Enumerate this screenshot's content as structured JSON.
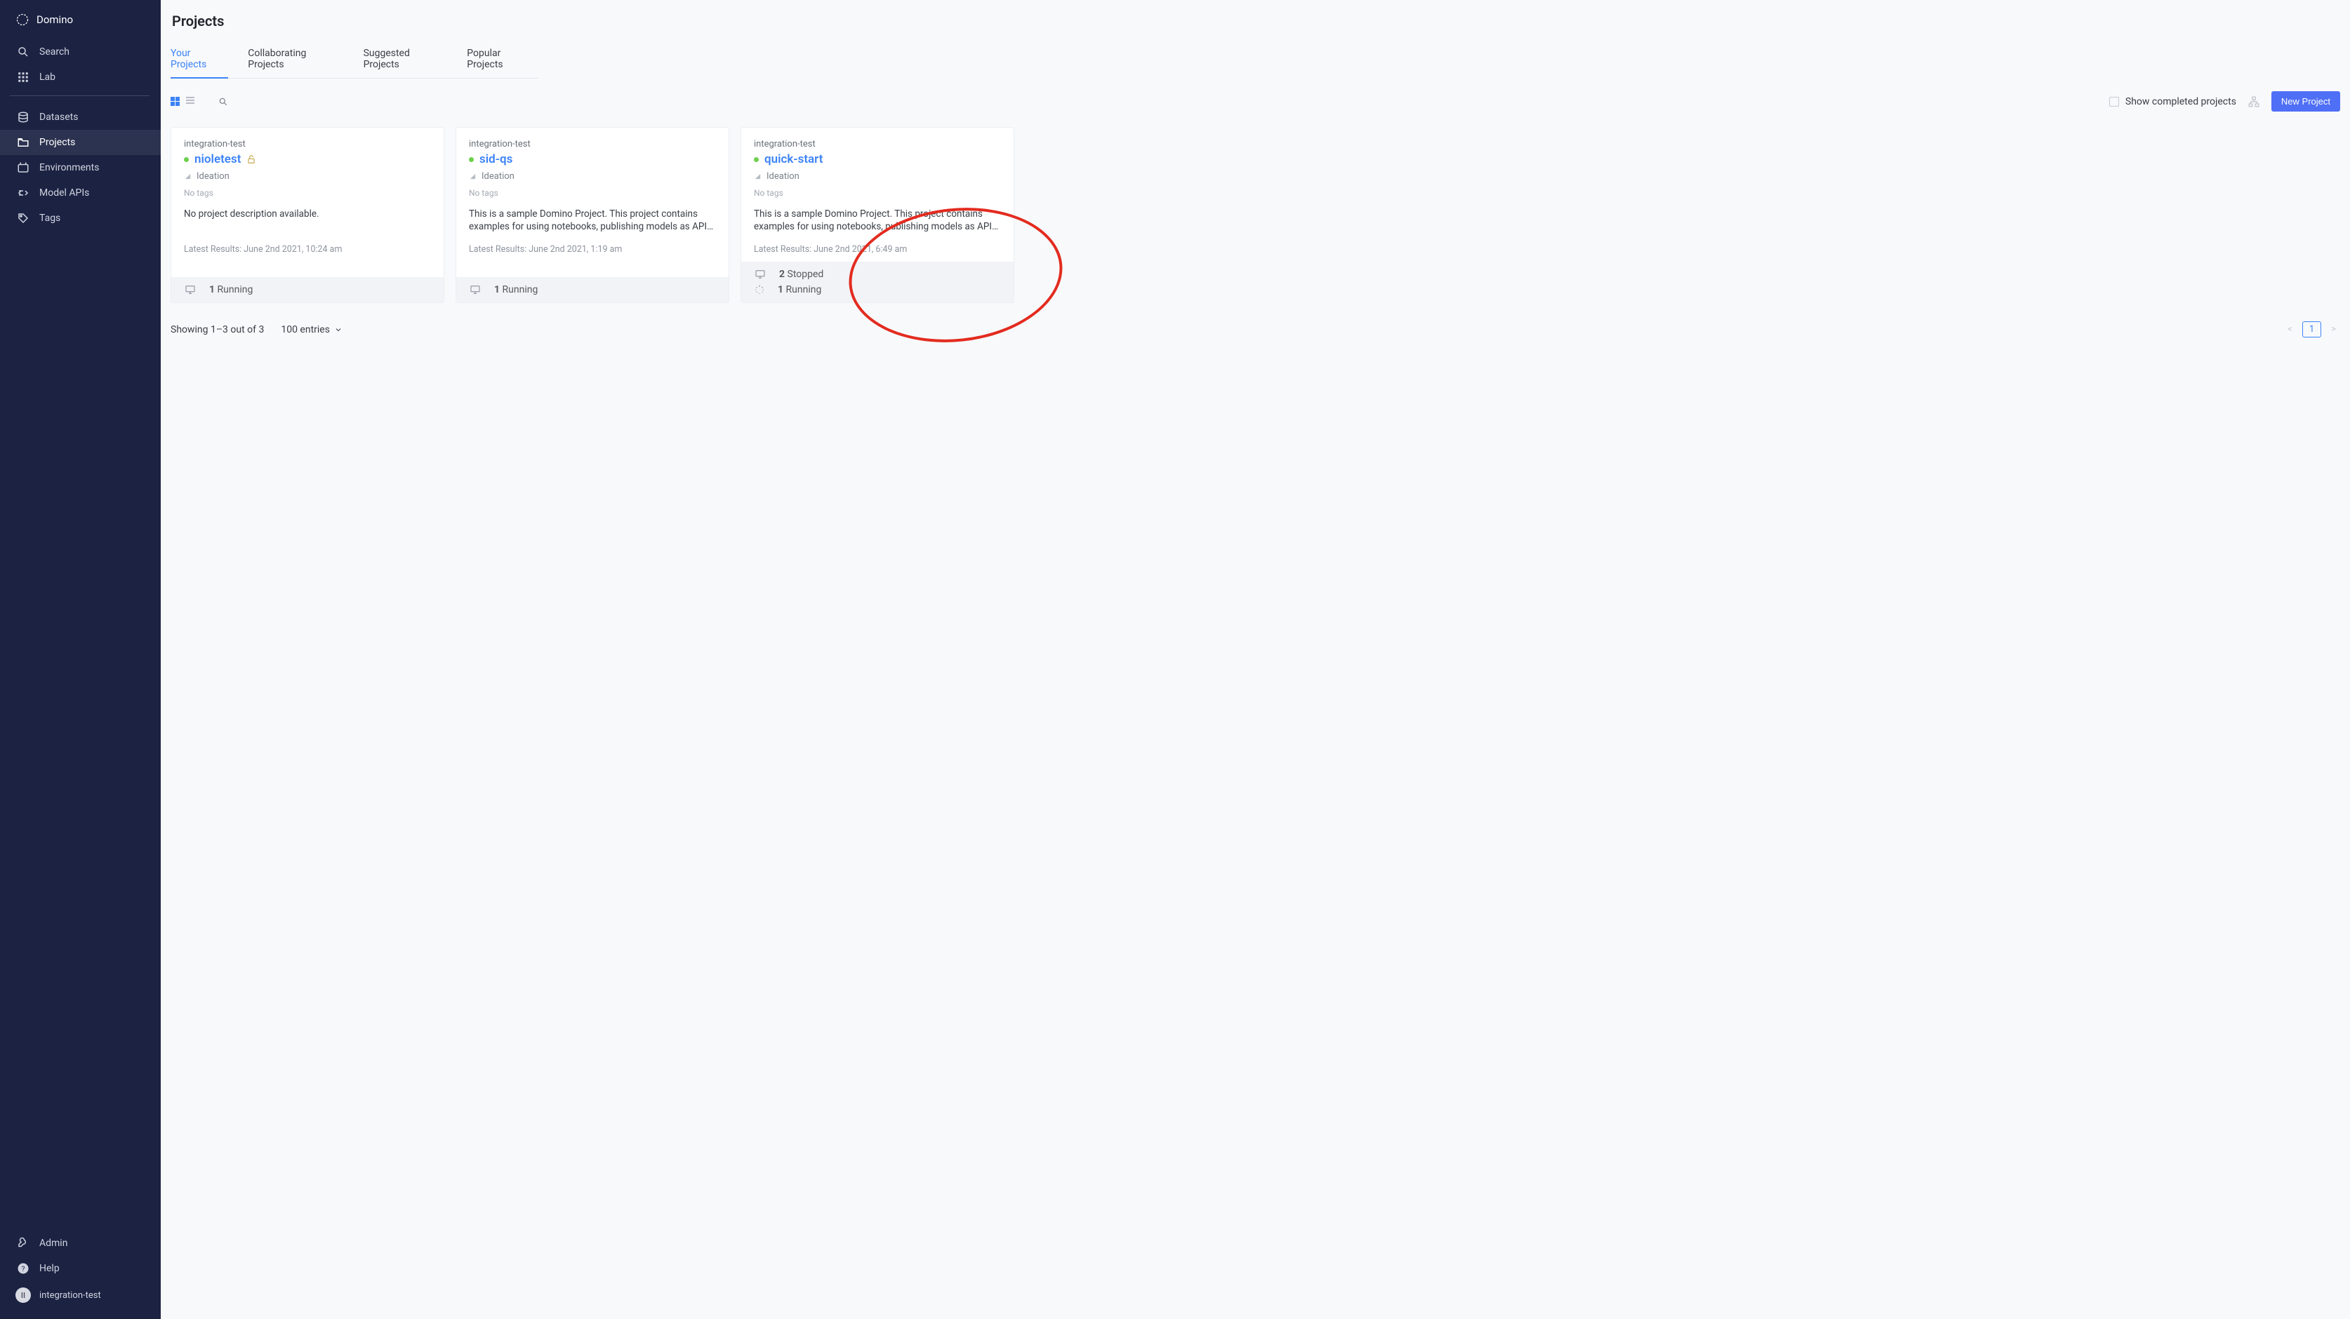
{
  "brand": "Domino",
  "sidebar": {
    "top": [
      {
        "icon": "search-icon",
        "label": "Search"
      },
      {
        "icon": "lab-icon",
        "label": "Lab"
      }
    ],
    "mid": [
      {
        "icon": "datasets-icon",
        "label": "Datasets"
      },
      {
        "icon": "projects-icon",
        "label": "Projects",
        "active": true
      },
      {
        "icon": "environments-icon",
        "label": "Environments"
      },
      {
        "icon": "model-apis-icon",
        "label": "Model APIs"
      },
      {
        "icon": "tags-icon",
        "label": "Tags"
      }
    ],
    "footer": [
      {
        "icon": "admin-icon",
        "label": "Admin"
      },
      {
        "icon": "help-icon",
        "label": "Help"
      }
    ],
    "user": {
      "initials": "II",
      "name": "integration-test"
    }
  },
  "page": {
    "title": "Projects",
    "tabs": [
      "Your Projects",
      "Collaborating Projects",
      "Suggested Projects",
      "Popular Projects"
    ],
    "toolbar": {
      "show_completed_label": "Show completed projects",
      "new_project_label": "New Project"
    },
    "cards": [
      {
        "owner": "integration-test",
        "title": "nioletest",
        "locked": true,
        "stage": "Ideation",
        "tags": "No tags",
        "description": "No project description available.",
        "results": "Latest Results: June 2nd 2021, 10:24 am",
        "runs": [
          {
            "icon": "monitor-icon",
            "count": "1",
            "label": "Running"
          }
        ]
      },
      {
        "owner": "integration-test",
        "title": "sid-qs",
        "locked": false,
        "stage": "Ideation",
        "tags": "No tags",
        "description": "This is a sample Domino Project. This project contains examples for using notebooks, publishing models as APIs, and publishing…",
        "results": "Latest Results: June 2nd 2021, 1:19 am",
        "runs": [
          {
            "icon": "monitor-icon",
            "count": "1",
            "label": "Running"
          }
        ]
      },
      {
        "owner": "integration-test",
        "title": "quick-start",
        "locked": false,
        "stage": "Ideation",
        "tags": "No tags",
        "description": "This is a sample Domino Project. This project contains examples for using notebooks, publishing models as APIs, and publishing…",
        "results": "Latest Results: June 2nd 2021, 6:49 am",
        "runs": [
          {
            "icon": "monitor-icon",
            "count": "2",
            "label": "Stopped"
          },
          {
            "icon": "loading-icon",
            "count": "1",
            "label": "Running"
          }
        ]
      }
    ],
    "footer": {
      "showing": "Showing 1–3 out of 3",
      "entries": "100 entries",
      "page": "1"
    }
  }
}
